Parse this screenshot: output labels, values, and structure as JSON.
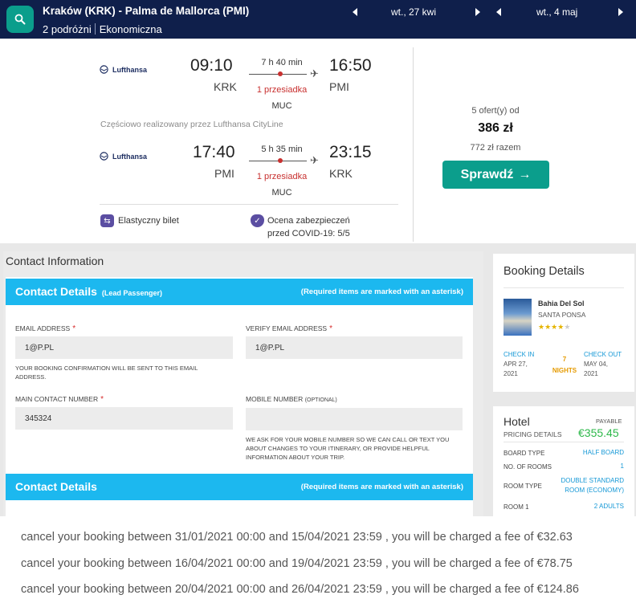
{
  "search": {
    "route": "Kraków (KRK) - Palma de Mallorca (PMI)",
    "travellers": "2 podróżni",
    "cabin": "Ekonomiczna",
    "depart_date": "wt., 27 kwi",
    "return_date": "wt., 4 maj"
  },
  "outbound": {
    "airline": "Lufthansa",
    "depart_time": "09:10",
    "depart_code": "KRK",
    "duration": "7 h 40 min",
    "stops": "1 przesiadka",
    "via": "MUC",
    "arrive_time": "16:50",
    "arrive_code": "PMI"
  },
  "operated_by": "Częściowo realizowany przez Lufthansa CityLine",
  "inbound": {
    "airline": "Lufthansa",
    "depart_time": "17:40",
    "depart_code": "PMI",
    "duration": "5 h 35 min",
    "stops": "1 przesiadka",
    "via": "MUC",
    "arrive_time": "23:15",
    "arrive_code": "KRK"
  },
  "features": {
    "flexible": "Elastyczny bilet",
    "covid_line1": "Ocena zabezpieczeń",
    "covid_line2": "przed COVID-19: 5/5"
  },
  "pricing": {
    "offers": "5 ofert(y) od",
    "price": "386 zł",
    "total": "772 zł razem",
    "check_label": "Sprawdź"
  },
  "contact": {
    "title": "Contact Information",
    "bar1_title": "Contact Details",
    "bar1_lead": "(Lead Passenger)",
    "bar_required": "(Required items are marked with an asterisk)",
    "email_label": "EMAIL ADDRESS",
    "email_value": "1@P.PL",
    "verify_label": "VERIFY EMAIL ADDRESS",
    "verify_value": "1@P.PL",
    "email_help": "YOUR BOOKING CONFIRMATION WILL BE SENT TO THIS EMAIL ADDRESS.",
    "main_label": "MAIN CONTACT NUMBER",
    "main_value": "345324",
    "mobile_label": "MOBILE NUMBER",
    "mobile_optional": "(OPTIONAL)",
    "mobile_value": "",
    "mobile_help": "WE ASK FOR YOUR MOBILE NUMBER SO WE CAN CALL OR TEXT YOU ABOUT CHANGES TO YOUR ITINERARY, OR PROVIDE HELPFUL INFORMATION ABOUT YOUR TRIP.",
    "bar2_title": "Contact Details",
    "asterisk": "*"
  },
  "booking": {
    "title": "Booking Details",
    "hotel_name": "Bahia Del Sol",
    "hotel_location": "SANTA PONSA",
    "stars": 4,
    "stars_max": 5,
    "checkin_label": "CHECK IN",
    "checkin_date": "APR 27,",
    "checkin_year": "2021",
    "nights_num": "7",
    "nights_label": "NIGHTS",
    "checkout_label": "CHECK OUT",
    "checkout_date": "MAY 04,",
    "checkout_year": "2021"
  },
  "hotel_pricing": {
    "title": "Hotel",
    "subtitle": "PRICING DETAILS",
    "payable": "PAYABLE",
    "amount": "€355.45",
    "board_key": "BOARD TYPE",
    "board_val": "HALF BOARD",
    "rooms_key": "NO. OF ROOMS",
    "rooms_val": "1",
    "roomtype_key": "ROOM TYPE",
    "roomtype_val1": "DOUBLE STANDARD",
    "roomtype_val2": "ROOM (ECONOMY)",
    "room1_key": "ROOM 1",
    "room1_val": "2 ADULTS"
  },
  "cancellation": [
    "cancel your booking between 31/01/2021 00:00 and 15/04/2021 23:59 , you will be charged a fee of €32.63",
    "cancel your booking between 16/04/2021 00:00 and 19/04/2021 23:59 , you will be charged a fee of €78.75",
    "cancel your booking between 20/04/2021 00:00 and 26/04/2021 23:59 , you will be charged a fee of €124.86"
  ],
  "colors": {
    "nav_bg": "#0f1f4b",
    "accent_teal": "#0b9e8c",
    "form_bar_blue": "#1cb8ef",
    "stop_red": "#c8302f",
    "price_green": "#2db84a",
    "link_blue": "#1598d6"
  },
  "icons": [
    "search-icon",
    "lufthansa-logo-icon",
    "plane-icon",
    "flexible-ticket-icon",
    "shield-icon",
    "arrow-right-icon",
    "chevron-left-icon",
    "chevron-right-icon",
    "star-icon"
  ]
}
